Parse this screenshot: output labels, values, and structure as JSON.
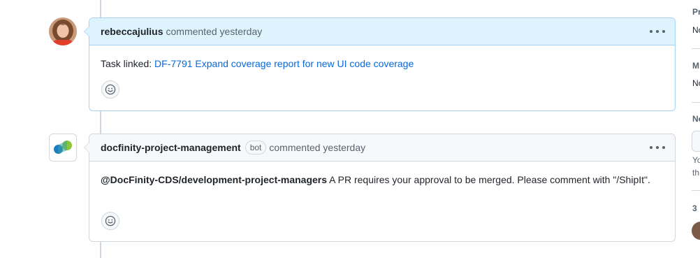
{
  "timeline": {
    "comments": [
      {
        "author": "rebeccajulius",
        "meta": "commented yesterday",
        "body_prefix": "Task linked: ",
        "link_text": "DF-7791 Expand coverage report for new UI code coverage"
      },
      {
        "author": "docfinity-project-management",
        "badge": "bot",
        "meta": "commented yesterday",
        "mention": "@DocFinity-CDS/development-project-managers",
        "body_text": " A PR requires your approval to be merged. Please comment with \"/ShipIt\"."
      }
    ]
  },
  "sidebar": {
    "sections": [
      {
        "title": "Pr",
        "value": "No"
      },
      {
        "title": "M",
        "value": "No"
      },
      {
        "title": "No",
        "line1": "Yo",
        "line2": "th"
      },
      {
        "title": "3"
      }
    ]
  },
  "icons": {
    "kebab": "kebab-horizontal-icon",
    "reaction": "smiley-icon"
  },
  "colors": {
    "link": "#0969da",
    "highlight_header": "#ddf4ff",
    "highlight_border": "#a6d1f7",
    "bot_logo_blue": "#1a7fc1",
    "bot_logo_green": "#8cc63f"
  }
}
